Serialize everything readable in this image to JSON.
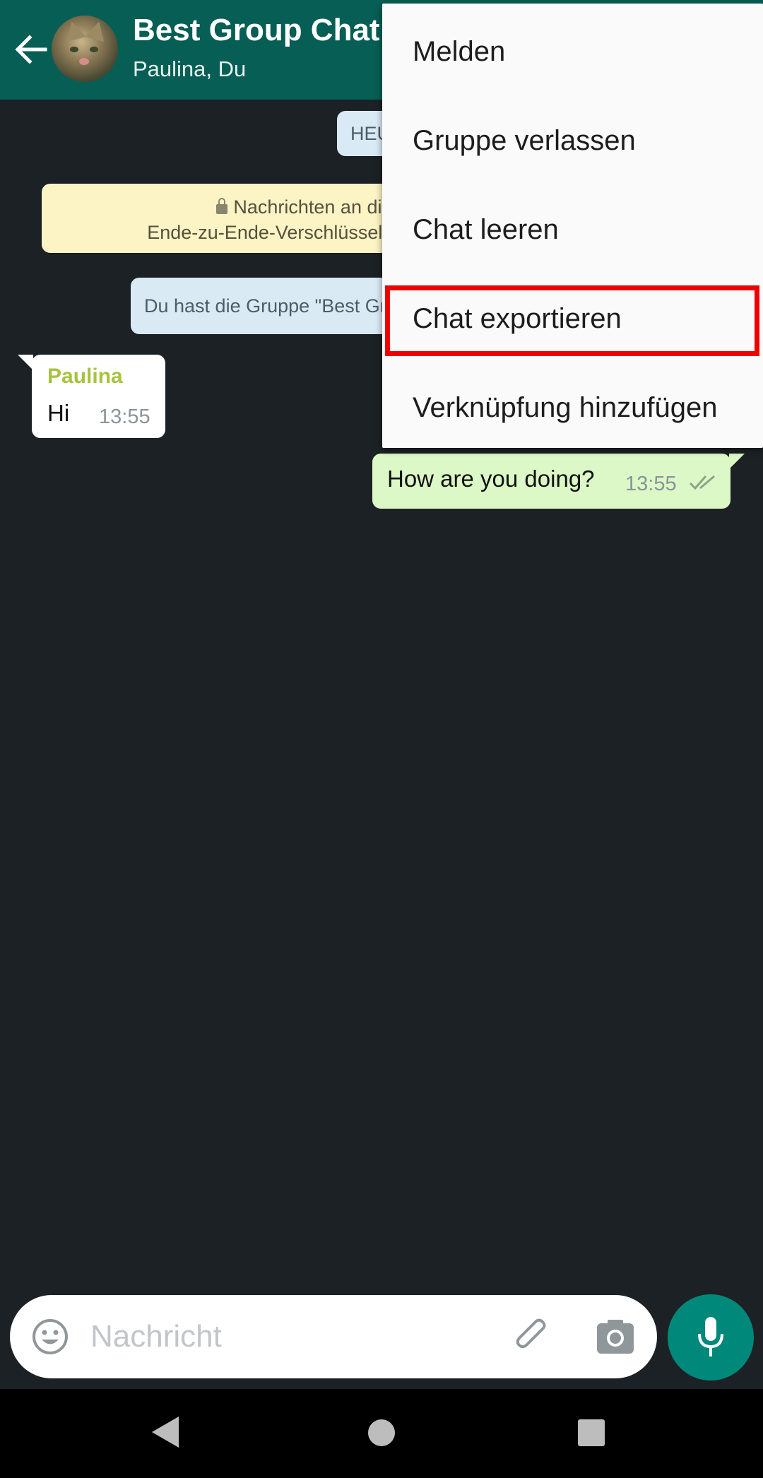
{
  "header": {
    "title": "Best Group Chat",
    "subtitle": "Paulina, Du"
  },
  "chat": {
    "date_chip": "HEU",
    "encryption_notice": {
      "line1": "Nachrichten an dies",
      "line2": "Ende-zu-Ende-Verschlüsselung g"
    },
    "created_notice": "Du hast die Gruppe \"Best Gr",
    "messages": [
      {
        "direction": "incoming",
        "sender": "Paulina",
        "text": "Hi",
        "time": "13:55"
      },
      {
        "direction": "outgoing",
        "text": "How are you doing?",
        "time": "13:55",
        "status": "read"
      }
    ]
  },
  "menu": {
    "items": [
      {
        "label": "Melden"
      },
      {
        "label": "Gruppe verlassen"
      },
      {
        "label": "Chat leeren"
      },
      {
        "label": "Chat exportieren",
        "highlighted": true
      },
      {
        "label": "Verknüpfung hinzufügen"
      }
    ]
  },
  "composer": {
    "placeholder": "Nachricht"
  },
  "icons": {
    "back": "arrow-left-icon",
    "emoji": "smiley-icon",
    "attach": "paperclip-icon",
    "camera": "camera-icon",
    "mic": "microphone-icon",
    "read_receipt": "double-check-icon"
  },
  "colors": {
    "header": "#075e54",
    "background": "#1b2124",
    "outgoing_bubble": "#dcf8c6",
    "incoming_bubble": "#ffffff",
    "sender_name": "#a6c340",
    "highlight": "#ef0000",
    "mic_button": "#00897b"
  }
}
